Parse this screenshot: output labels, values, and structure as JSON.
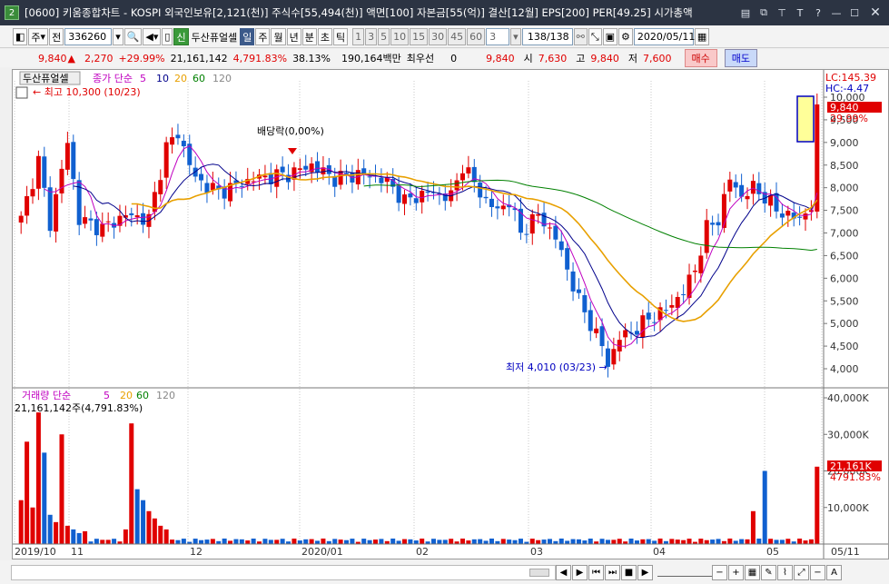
{
  "window": {
    "number": "2",
    "title": "[0600] 키움종합차트 - KOSPI 외국인보유[2,121(천)] 주식수[55,494(천)] 액면[100] 자본금[55(억)] 결산[12월] EPS[200] PER[49.25] 시가총액"
  },
  "toolbar": {
    "mode1": "주",
    "mode2": "전",
    "code": "336260",
    "badge": "신",
    "stock_name": "두산퓨얼셀",
    "periods": [
      "일",
      "주",
      "월",
      "년",
      "분",
      "초",
      "틱"
    ],
    "intervals": [
      "1",
      "3",
      "5",
      "10",
      "15",
      "30",
      "45",
      "60"
    ],
    "count_value": "3",
    "range": "138/138",
    "date": "2020/05/11"
  },
  "quote": {
    "price": "9,840",
    "arrow": "▲",
    "change": "2,270",
    "change_pct": "+29.99%",
    "volume": "21,161,142",
    "vol_pct": "4,791.83%",
    "turnover": "38.13%",
    "amount": "190,164백만",
    "pref_label": "최우선",
    "pref_value": "0",
    "last": "9,840",
    "open_label": "시",
    "open": "7,630",
    "high_label": "고",
    "high": "9,840",
    "low_label": "저",
    "low": "7,600",
    "buy": "매수",
    "sell": "매도"
  },
  "chart": {
    "stock_label": "두산퓨얼셀",
    "legend": {
      "main": "종가 단순",
      "ma5": "5",
      "ma10": "10",
      "ma20": "20",
      "ma60": "60",
      "ma120": "120"
    },
    "vol_legend": {
      "main": "거래량 단순",
      "ma5": "5",
      "ma20": "20",
      "ma60": "60",
      "ma120": "120"
    },
    "high_note": "최고 10,300 (10/23)",
    "low_note": "최저 4,010 (03/23)",
    "dividend_note": "배당락(0,00%)",
    "lc": "LC:145.39",
    "hc": "HC:-4.47",
    "last_price_tag": "9,840",
    "last_pct_tag": "29.99%",
    "vol_tag": "21,161K",
    "vol_pct_tag": "4791.83%",
    "vol_caption": "21,161,142주(4,791.83%)",
    "price_ticks": [
      "10,000",
      "9,500",
      "9,000",
      "8,500",
      "8,000",
      "7,500",
      "7,000",
      "6,500",
      "6,000",
      "5,500",
      "5,000",
      "4,500",
      "4,000"
    ],
    "vol_ticks": [
      "40,000K",
      "30,000K",
      "20,000K",
      "10,000K"
    ],
    "x_labels": [
      "2019/10",
      "11",
      "12",
      "2020/01",
      "02",
      "03",
      "04",
      "05",
      "05/11"
    ],
    "colors": {
      "up": "#e00000",
      "down": "#1060d0",
      "ma5": "#c000c0",
      "ma10": "#00008b",
      "ma20": "#e8a000",
      "ma60": "#008000",
      "highlight": "#ffff99"
    }
  },
  "status": {
    "buttons": [
      "◀",
      "▶",
      "⏮",
      "⏭",
      "■",
      "▶"
    ]
  }
}
